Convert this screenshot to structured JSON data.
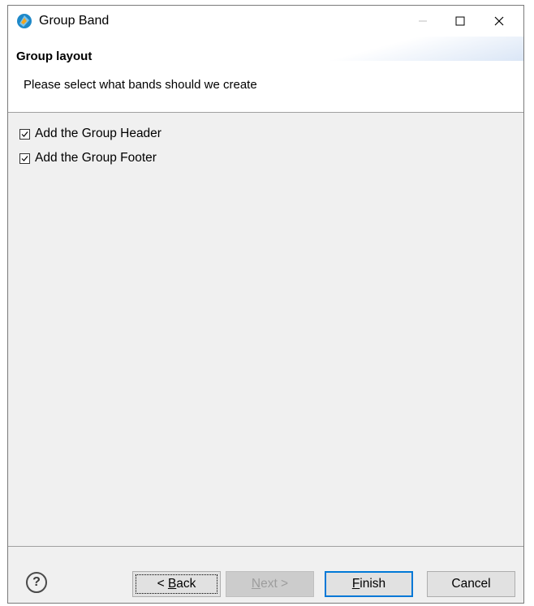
{
  "window": {
    "title": "Group Band",
    "icon": "eclipse-wizard-icon"
  },
  "header": {
    "title": "Group layout",
    "description": "Please select what bands should we create"
  },
  "options": [
    {
      "label": "Add the Group Header",
      "checked": true
    },
    {
      "label": "Add the Group Footer",
      "checked": true
    }
  ],
  "footer": {
    "help_icon": "question-mark-icon",
    "help_glyph": "?",
    "back": {
      "mnemonic": "B",
      "rest": "ack",
      "prefix": "< ",
      "enabled": true
    },
    "next": {
      "mnemonic": "N",
      "rest": "ext >",
      "enabled": false
    },
    "finish": {
      "mnemonic": "F",
      "rest": "inish",
      "enabled": true,
      "default": true
    },
    "cancel": {
      "label": "Cancel",
      "enabled": true
    }
  },
  "colors": {
    "accent": "#0078d7",
    "dialog_bg": "#f0f0f0",
    "header_bg": "#ffffff"
  }
}
